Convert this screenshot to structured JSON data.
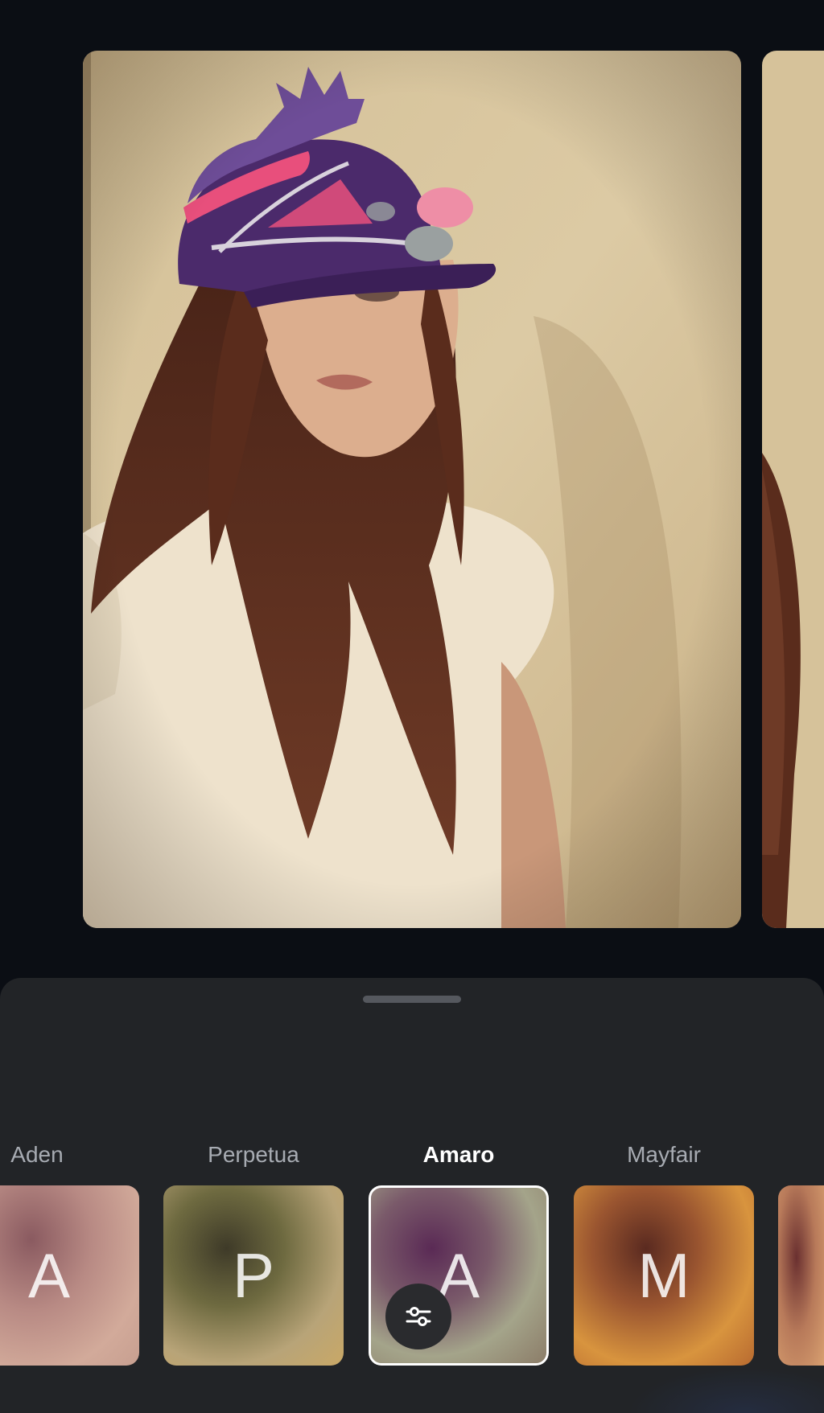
{
  "filters": [
    {
      "name": "Aden",
      "letter": "A",
      "selected": false
    },
    {
      "name": "Perpetua",
      "letter": "P",
      "selected": false
    },
    {
      "name": "Amaro",
      "letter": "A",
      "selected": true
    },
    {
      "name": "Mayfair",
      "letter": "M",
      "selected": false
    }
  ],
  "icons": {
    "adjust": "sliders-icon"
  },
  "colors": {
    "background": "#0b0e14",
    "sheet": "#222427",
    "active_label": "#ffffff",
    "inactive_label": "#a7abb2"
  }
}
